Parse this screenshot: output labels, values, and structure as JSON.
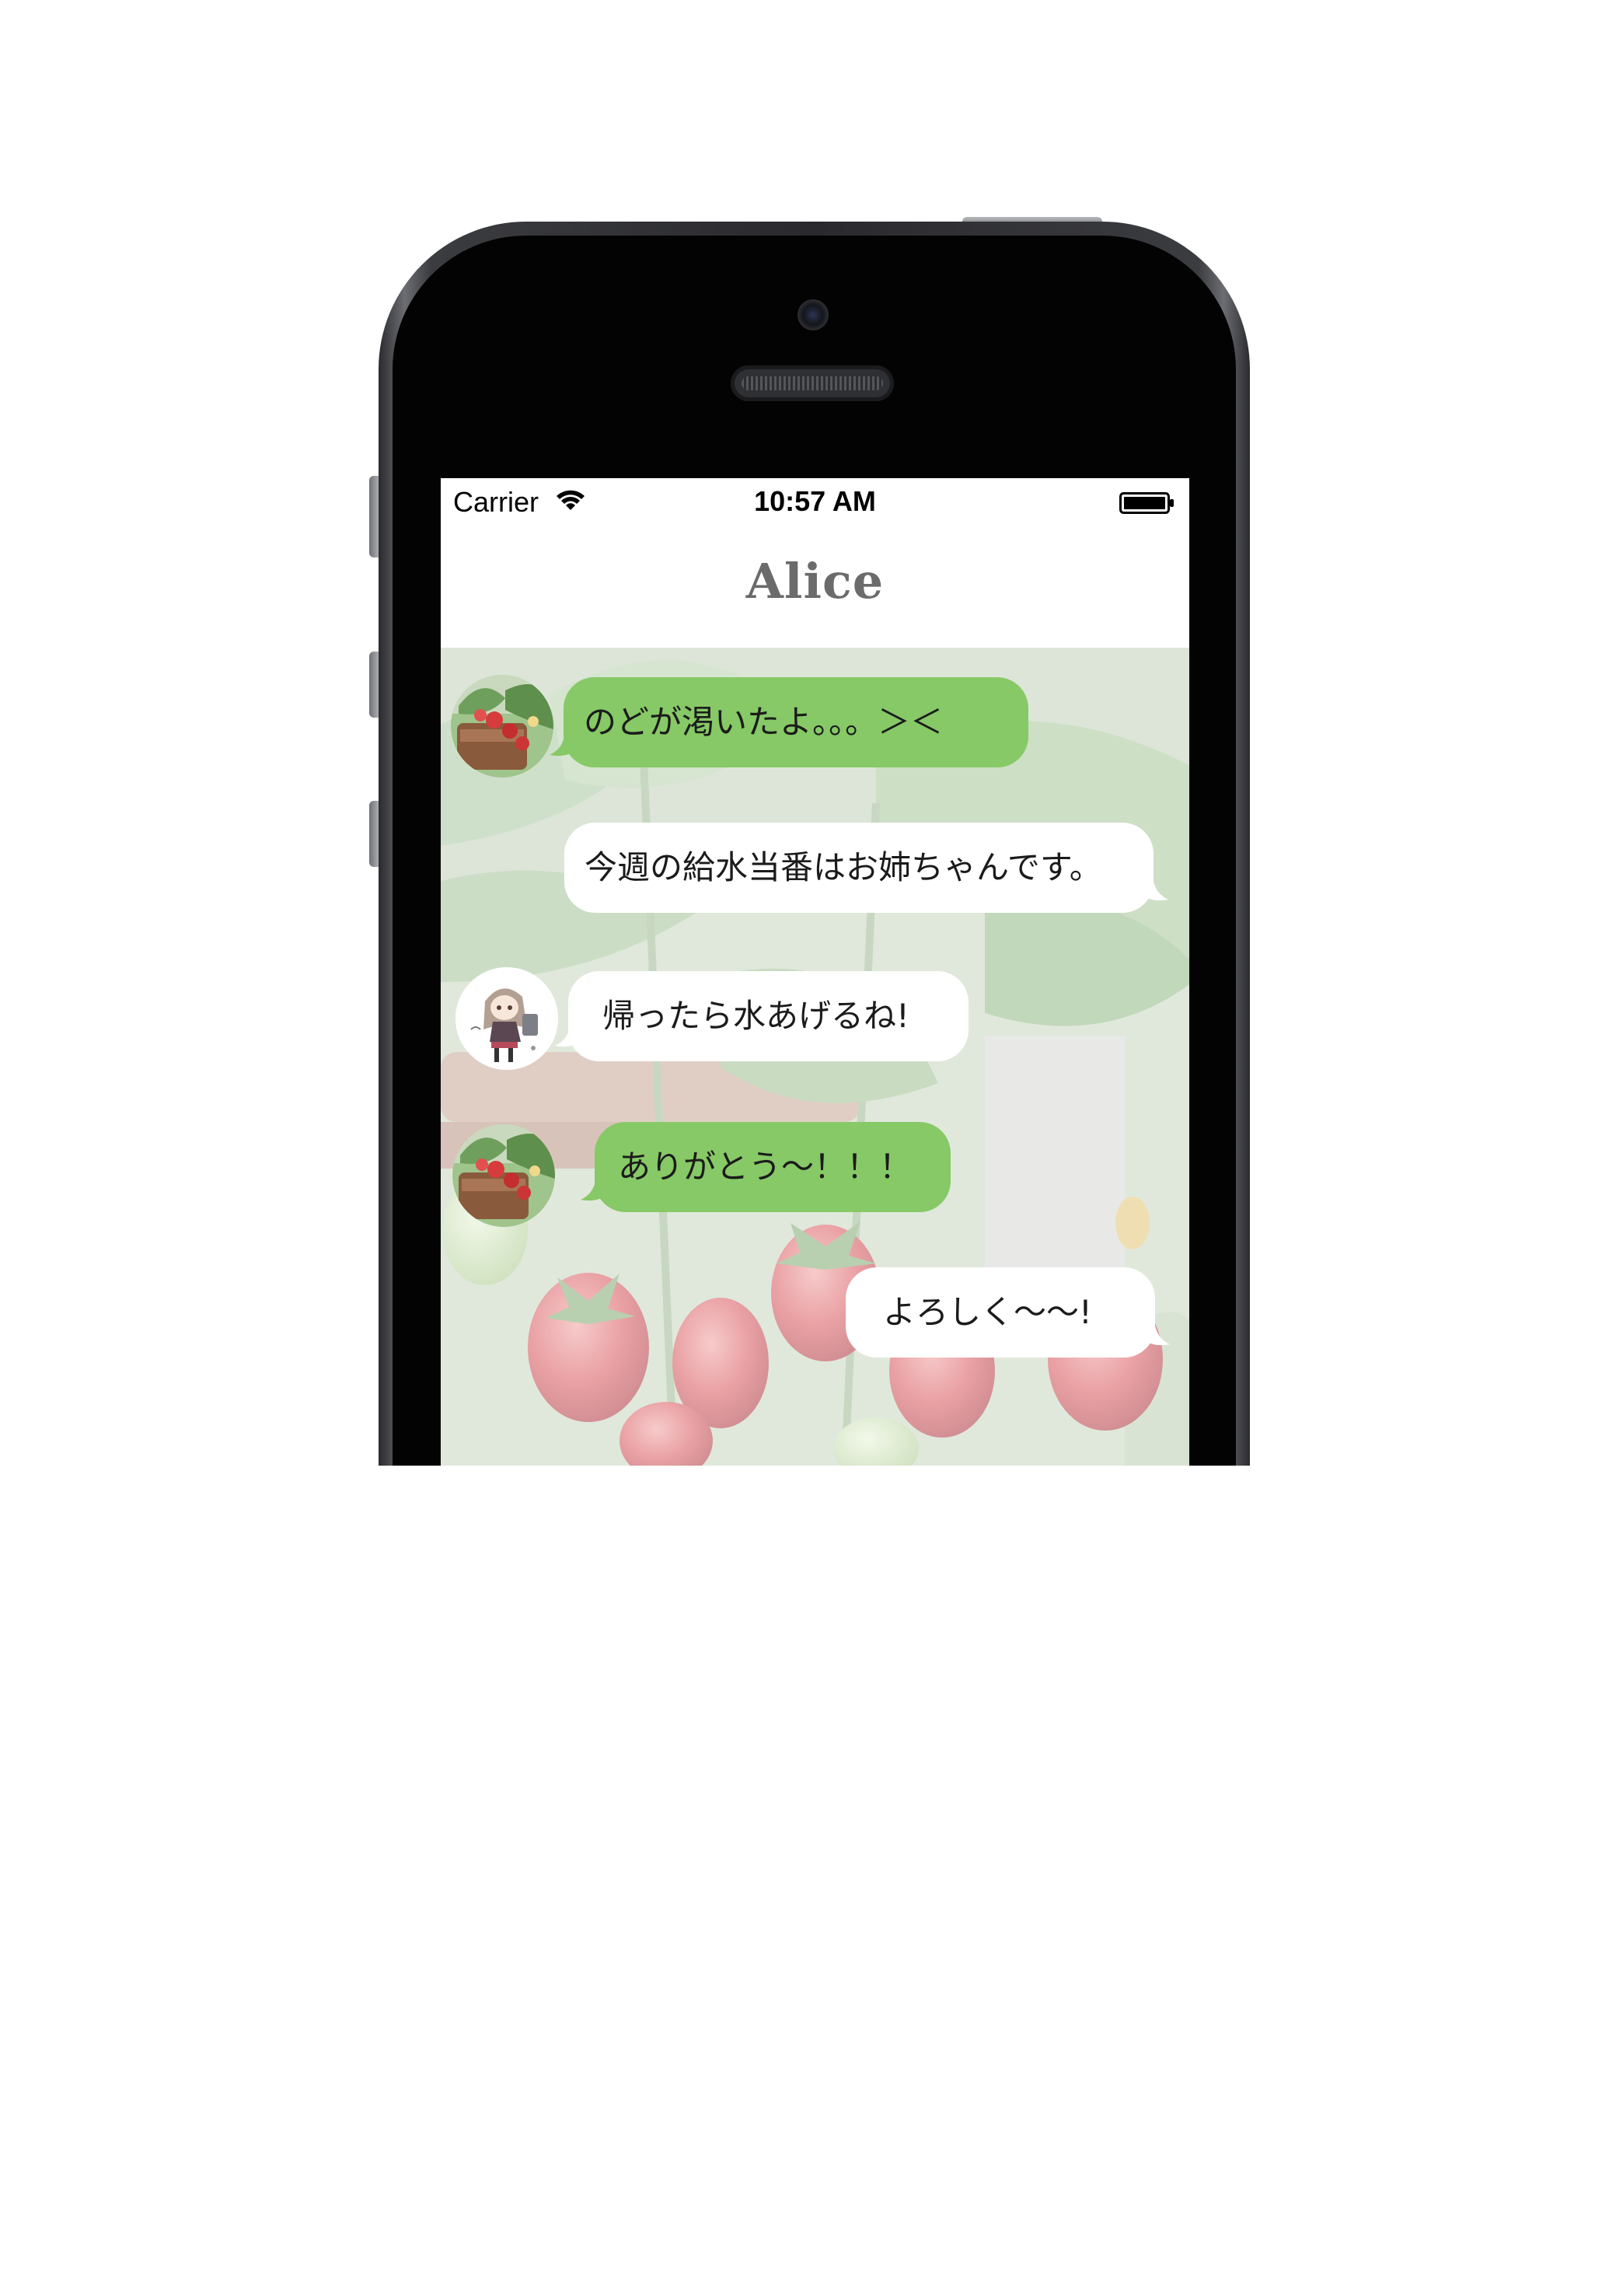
{
  "status_bar": {
    "carrier": "Carrier",
    "time": "10:57 AM"
  },
  "nav": {
    "title": "Alice"
  },
  "colors": {
    "incoming_bubble": "#86c966",
    "outgoing_bubble": "#ffffff",
    "title_text": "#6b6b6b"
  },
  "messages": [
    {
      "sender": "incoming",
      "avatar": "strawberry-plant-avatar",
      "text": "のどが渇いたよ。。。＞＜",
      "bubble_color": "green"
    },
    {
      "sender": "outgoing",
      "text": "今週の給水当番はお姉ちゃんです。",
      "bubble_color": "white"
    },
    {
      "sender": "incoming",
      "avatar": "anime-girl-avatar",
      "text": "帰ったら水あげるね!",
      "bubble_color": "white"
    },
    {
      "sender": "incoming",
      "avatar": "strawberry-plant-avatar",
      "text": "ありがとう～！！！",
      "bubble_color": "green"
    },
    {
      "sender": "outgoing",
      "text": "よろしく～～!",
      "bubble_color": "white"
    }
  ]
}
